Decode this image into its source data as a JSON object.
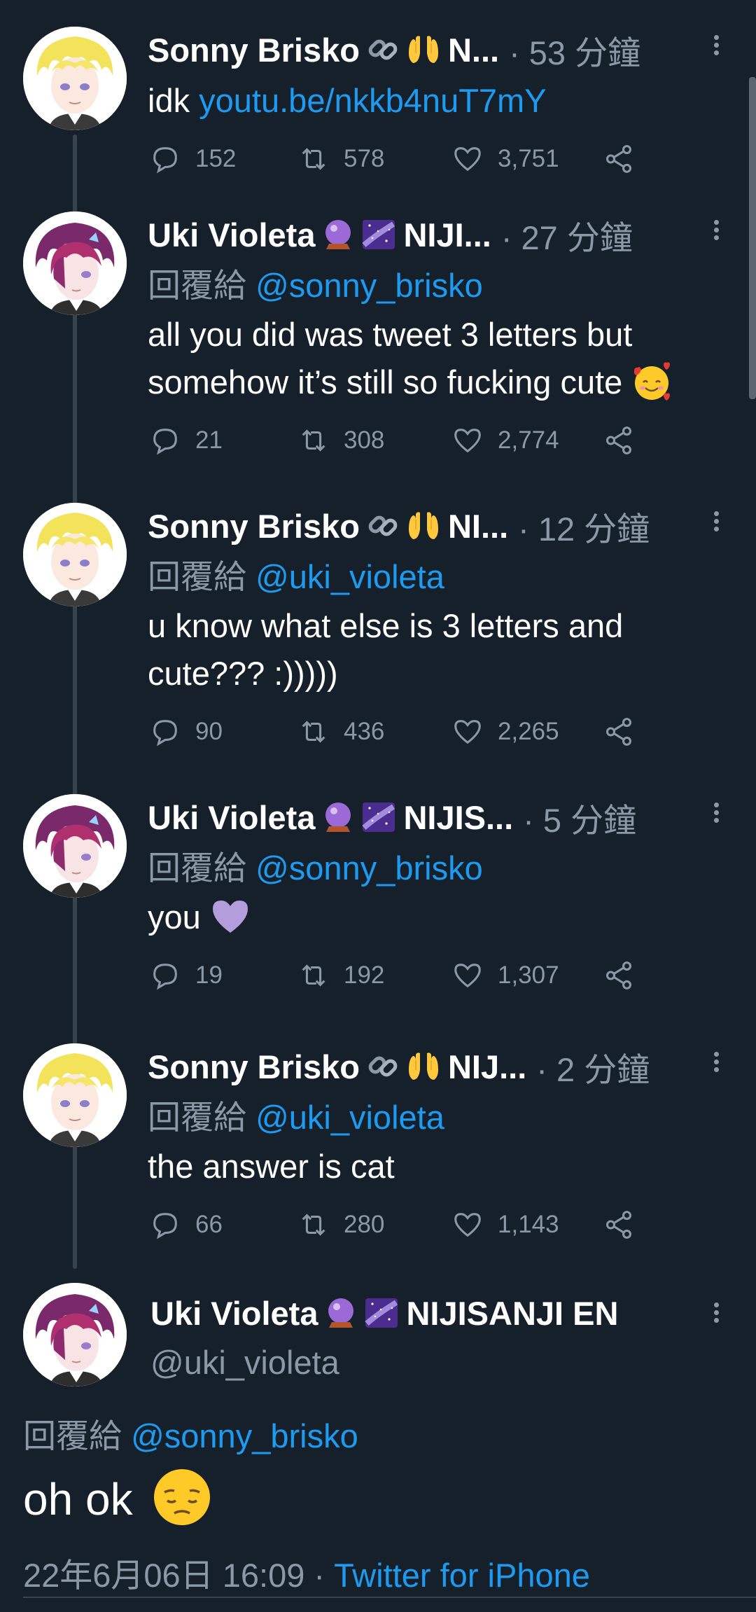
{
  "thread": [
    {
      "author": "Sonny Brisko",
      "badges": [
        "link-emoji",
        "palms-up-emoji"
      ],
      "name_suffix": "N...",
      "time": "· 53 分鐘",
      "reply_prefix": "",
      "reply_handle": "",
      "text_before": "idk ",
      "link": "youtu.be/nkkb4nuT7mY",
      "text_after": "",
      "replies": "152",
      "retweets": "578",
      "likes": "3,751"
    },
    {
      "author": "Uki Violeta",
      "badges": [
        "crystal-ball-emoji",
        "milky-way-emoji"
      ],
      "name_suffix": "NIJI...",
      "time": "· 27 分鐘",
      "reply_prefix": "回覆給 ",
      "reply_handle": "@sonny_brisko",
      "text": "all you did was tweet 3 letters but somehow it’s still so fucking cute",
      "emoji": "smiling-face-with-hearts-emoji",
      "replies": "21",
      "retweets": "308",
      "likes": "2,774"
    },
    {
      "author": "Sonny Brisko",
      "badges": [
        "link-emoji",
        "palms-up-emoji"
      ],
      "name_suffix": "NI...",
      "time": "· 12 分鐘",
      "reply_prefix": "回覆給 ",
      "reply_handle": "@uki_violeta",
      "text": "u know what else is 3 letters and cute??? :)))))",
      "replies": "90",
      "retweets": "436",
      "likes": "2,265"
    },
    {
      "author": "Uki Violeta",
      "badges": [
        "crystal-ball-emoji",
        "milky-way-emoji"
      ],
      "name_suffix": "NIJIS...",
      "time": "· 5 分鐘",
      "reply_prefix": "回覆給 ",
      "reply_handle": "@sonny_brisko",
      "text": "you",
      "emoji": "purple-heart-emoji",
      "replies": "19",
      "retweets": "192",
      "likes": "1,307"
    },
    {
      "author": "Sonny Brisko",
      "badges": [
        "link-emoji",
        "palms-up-emoji"
      ],
      "name_suffix": "NIJ...",
      "time": "· 2 分鐘",
      "reply_prefix": "回覆給 ",
      "reply_handle": "@uki_violeta",
      "text": "the answer is cat",
      "replies": "66",
      "retweets": "280",
      "likes": "1,143"
    }
  ],
  "main": {
    "author": "Uki Violeta",
    "name_suffix": "NIJISANJI EN",
    "handle": "@uki_violeta",
    "reply_prefix": "回覆給 ",
    "reply_handle": "@sonny_brisko",
    "text": "oh ok",
    "emoji": "pensive-face-emoji",
    "timestamp": "22年6月06日 16:09",
    "separator": " · ",
    "app": "Twitter for iPhone"
  },
  "colors": {
    "background": "#15202b",
    "accent": "#1d9bf0",
    "muted": "#8b98a5",
    "thread_line": "#38444d"
  }
}
